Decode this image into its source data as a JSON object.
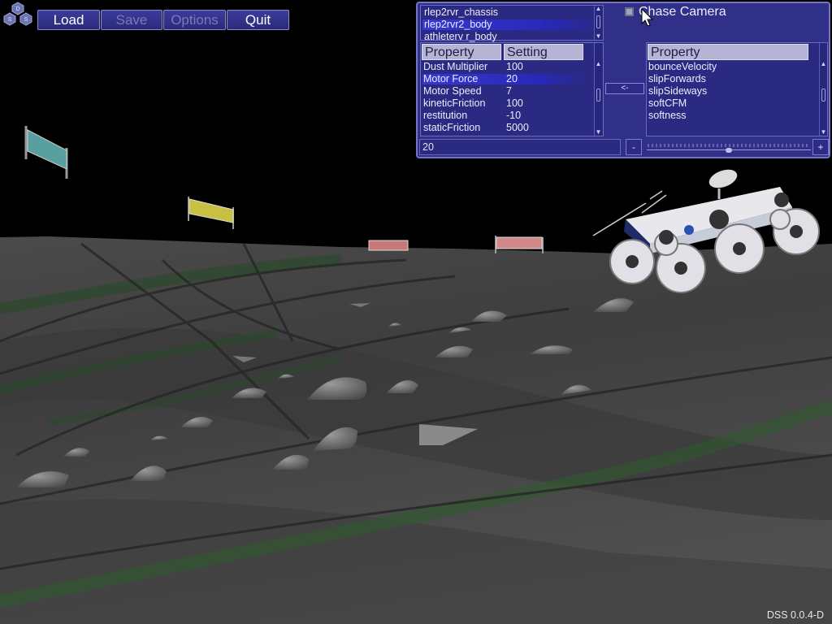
{
  "logo": {
    "letters": [
      "D",
      "S",
      "S"
    ],
    "icon": "dss-hex-logo"
  },
  "toolbar": {
    "load_label": "Load",
    "save_label": "Save",
    "options_label": "Options",
    "quit_label": "Quit"
  },
  "panel": {
    "objects": [
      "rlep2rvr_chassis",
      "rlep2rvr2_body",
      "athleterv r_body"
    ],
    "selected_object": "rlep2rvr2_body",
    "settings_table": {
      "headers": [
        "Property",
        "Setting"
      ],
      "rows": [
        {
          "property": "Dust Multiplier",
          "setting": "100"
        },
        {
          "property": "Motor Force",
          "setting": "20"
        },
        {
          "property": "Motor Speed",
          "setting": "7"
        },
        {
          "property": "kineticFriction",
          "setting": "100"
        },
        {
          "property": "restitution",
          "setting": "-10"
        },
        {
          "property": "staticFriction",
          "setting": "5000"
        }
      ],
      "selected_row": "Motor Force"
    },
    "available_header": "Property",
    "available_properties": [
      "bounceVelocity",
      "slipForwards",
      "slipSideways",
      "softCFM",
      "softness"
    ],
    "move_button_label": "<-",
    "chase_camera_label": "Chase Camera",
    "chase_camera_checked": true,
    "value_field": "20",
    "decrement_label": "-",
    "increment_label": "+",
    "slider_level": 0.5
  },
  "version": "DSS 0.0.4-D",
  "colors": {
    "panel_bg": "#303088",
    "button_bg": "#34348c",
    "selection": "#3030c8"
  }
}
